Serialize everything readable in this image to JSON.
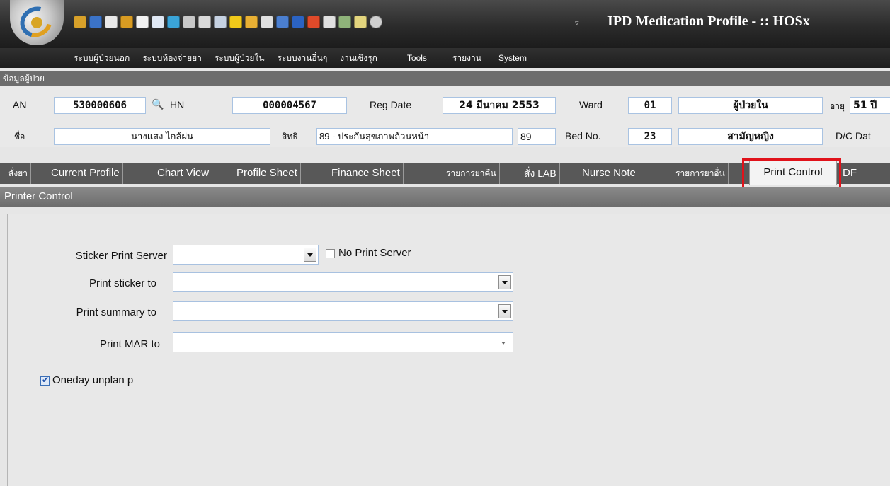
{
  "app": {
    "title": "IPD Medication Profile - :: HOSx",
    "accent": "#2b2b2b"
  },
  "menu": [
    "ระบบผู้ป่วยนอก",
    "ระบบห้องจ่ายยา",
    "ระบบผู้ป่วยใน",
    "ระบบงานอื่นๆ",
    "งานเชิงรุก",
    "Tools",
    "รายงาน",
    "System"
  ],
  "patient": {
    "section_title": "ข้อมูลผู้ป่วย",
    "an_label": "AN",
    "an_value": "530000606",
    "hn_label": "HN",
    "hn_value": "000004567",
    "regdate_label": "Reg Date",
    "regdate_value": "24 มีนาคม 2553",
    "ward_label": "Ward",
    "ward_code": "01",
    "ward_name": "ผู้ป่วยใน",
    "age_label": "อายุ",
    "age_value": "51 ปี",
    "name_label": "ชื่อ",
    "name_value": "นางแสง ไกล้ฝน",
    "right_label": "สิทธิ",
    "right_value": "89 - ประกันสุขภาพถ้วนหน้า",
    "right_code": "89",
    "bed_label": "Bed No.",
    "bed_value": "23",
    "bed_name": "สามัญหญิง",
    "dc_label": "D/C Dat"
  },
  "tabs": [
    "สั่งยา",
    "Current Profile",
    "Chart View",
    "Profile Sheet",
    "Finance Sheet",
    "รายการยาคืน",
    "สั่ง LAB",
    "Nurse Note",
    "รายการยาอื่น",
    "Print Control",
    "DF"
  ],
  "active_tab": "Print Control",
  "printer": {
    "header": "Printer Control",
    "sticker_server_label": "Sticker Print Server",
    "sticker_server_value": "",
    "no_server_label": "No Print Server",
    "no_server_checked": false,
    "sticker_to_label": "Print sticker to",
    "sticker_to_value": "",
    "summary_to_label": "Print summary to",
    "summary_to_value": "",
    "mar_to_label": "Print MAR to",
    "mar_to_value": "",
    "oneday_label": "Oneday unplan p",
    "oneday_checked": true
  }
}
